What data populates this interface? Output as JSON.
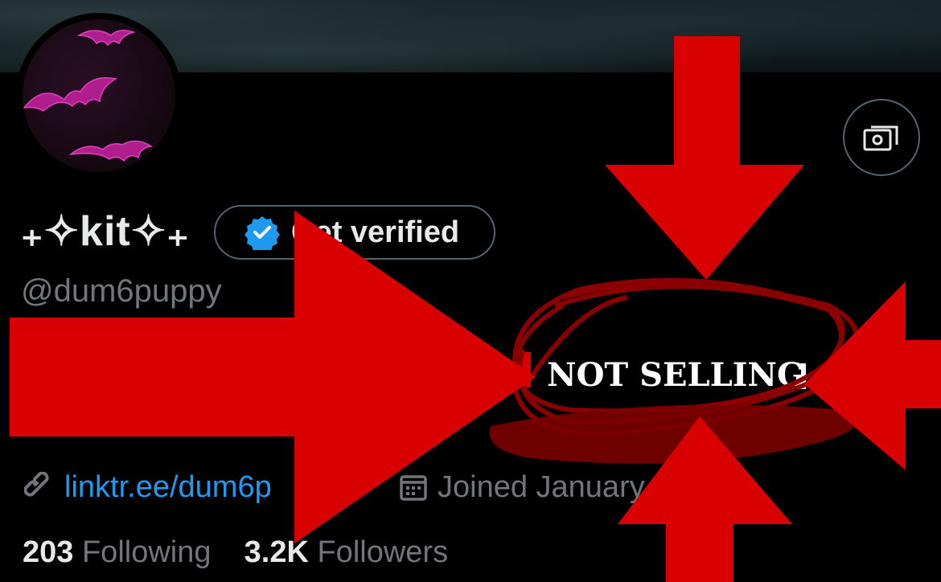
{
  "profile": {
    "display_name": "₊✧kit✧₊",
    "handle": "@dum6puppy",
    "verify_button": "Get verified",
    "bio": "NOT SELLING",
    "link": "linktr.ee/dum6p",
    "joined": "Joined January",
    "following_count": "203",
    "following_label": "Following",
    "followers_count": "3.2K",
    "followers_label": "Followers"
  },
  "icons": {
    "verified": "verified-badge-icon",
    "link": "link-icon",
    "calendar": "calendar-icon",
    "money": "money-icon"
  },
  "colors": {
    "accent_blue": "#1d9bf0",
    "muted": "#71767b",
    "annotation_red": "#d80000",
    "scribble_red": "#8a0000"
  }
}
